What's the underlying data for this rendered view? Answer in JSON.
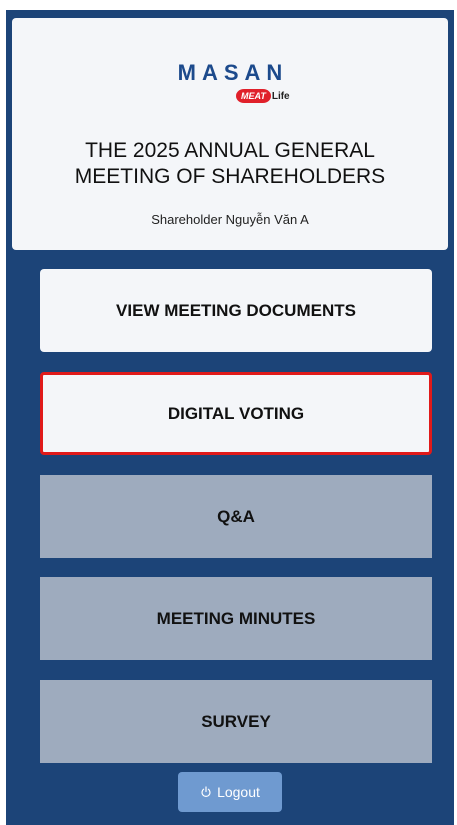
{
  "brand": {
    "name": "MASAN",
    "sub_badge": "MEAT",
    "sub_text": "Life"
  },
  "meeting": {
    "title_line1": "THE 2025 ANNUAL GENERAL",
    "title_line2": "MEETING OF SHAREHOLDERS",
    "shareholder": "Shareholder Nguyễn Văn A"
  },
  "menu": {
    "documents": "VIEW MEETING DOCUMENTS",
    "voting": "DIGITAL VOTING",
    "qa": "Q&A",
    "minutes": "MEETING MINUTES",
    "survey": "SURVEY"
  },
  "logout": {
    "icon": "power-icon",
    "label": "Logout"
  },
  "colors": {
    "background": "#1c4478",
    "card": "#f4f6f9",
    "muted_button": "#9eabbe",
    "active_border": "#e01a1a",
    "logout_button": "#6f9ad0",
    "brand_blue": "#1c4a8c",
    "brand_red": "#e0202a"
  }
}
